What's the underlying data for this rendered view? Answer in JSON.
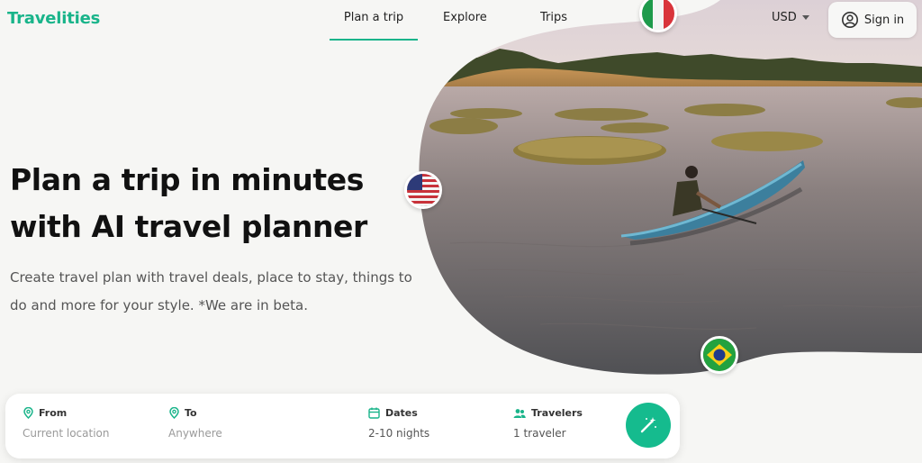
{
  "app": {
    "brand": "Travelities"
  },
  "nav": {
    "items": [
      {
        "label": "Plan a trip",
        "active": true
      },
      {
        "label": "Explore"
      },
      {
        "label": "Trips"
      }
    ]
  },
  "header": {
    "currency": "USD",
    "signin_label": "Sign in"
  },
  "hero": {
    "title": "Plan a trip in minutes with AI travel planner",
    "subtitle": "Create travel plan with travel deals, place to stay, things to do and more for your style. *We are in beta."
  },
  "search": {
    "from": {
      "label": "From",
      "placeholder": "Current location"
    },
    "to": {
      "label": "To",
      "placeholder": "Anywhere"
    },
    "dates": {
      "label": "Dates",
      "value": "2-10 nights"
    },
    "travelers": {
      "label": "Travelers",
      "value": "1 traveler"
    }
  },
  "icons": {
    "pin": "map-pin-icon",
    "calendar": "calendar-icon",
    "travelers": "people-icon",
    "go": "magic-wand-icon",
    "account": "user-circle-icon"
  },
  "colors": {
    "accent": "#19b48a",
    "button": "#15bb8e",
    "background": "#f6f6f4"
  }
}
